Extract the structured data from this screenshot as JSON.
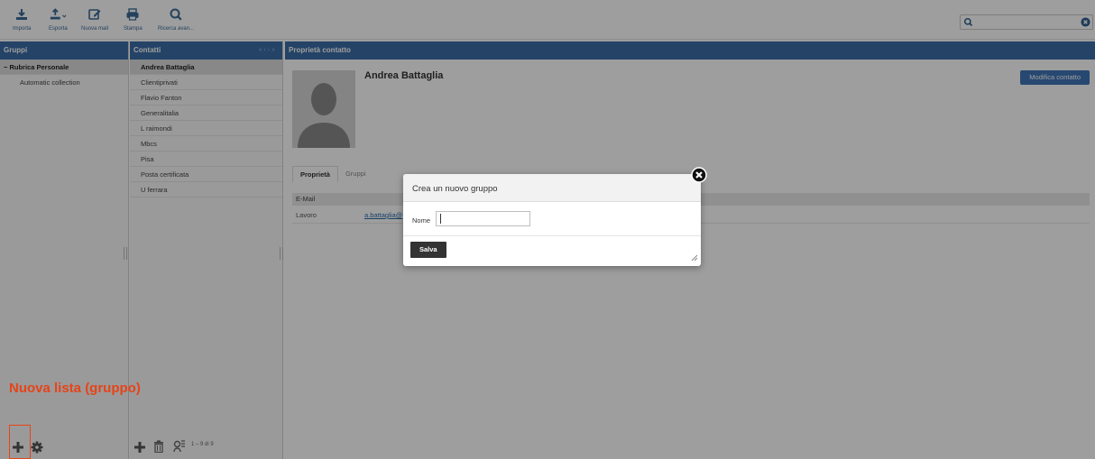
{
  "toolbar": {
    "buttons": [
      {
        "label": "Importa",
        "icon": "import-icon"
      },
      {
        "label": "Esporta",
        "icon": "export-icon"
      },
      {
        "label": "Nuova mail",
        "icon": "compose-icon"
      },
      {
        "label": "Stampa",
        "icon": "print-icon"
      },
      {
        "label": "Ricerca avan...",
        "icon": "search-icon"
      }
    ],
    "search": {
      "value": "",
      "placeholder": ""
    }
  },
  "groups": {
    "header": "Gruppi",
    "items": [
      {
        "label": "− Rubrica Personale",
        "selected": true
      },
      {
        "label": "Automatic collection",
        "selected": false
      }
    ]
  },
  "contacts": {
    "header": "Contatti",
    "nav_arrows": "«  ‹  ›  »",
    "items": [
      {
        "label": "Andrea Battaglia",
        "selected": true
      },
      {
        "label": "Clientiprivati"
      },
      {
        "label": "Flavio Fanton"
      },
      {
        "label": "Generalitalia"
      },
      {
        "label": "L raimondi"
      },
      {
        "label": "Mbcs"
      },
      {
        "label": "Pisa"
      },
      {
        "label": "Posta certificata"
      },
      {
        "label": "U ferrara"
      }
    ],
    "count": "1 – 9 di 9"
  },
  "properties": {
    "header": "Proprietà contatto",
    "name": "Andrea Battaglia",
    "edit_button": "Modifica contatto",
    "tabs": [
      "Proprietà",
      "Gruppi"
    ],
    "section": "E-Mail",
    "field_label": "Lavoro",
    "field_value": "a.battaglia@"
  },
  "dialog": {
    "title": "Crea un nuovo gruppo",
    "name_label": "Nome",
    "name_value": "",
    "save_button": "Salva"
  },
  "annotation": {
    "text": "Nuova lista (gruppo)",
    "color": "#e84317"
  },
  "colors": {
    "header_blue": "#3b6da6",
    "button_blue": "#3f74b6"
  }
}
